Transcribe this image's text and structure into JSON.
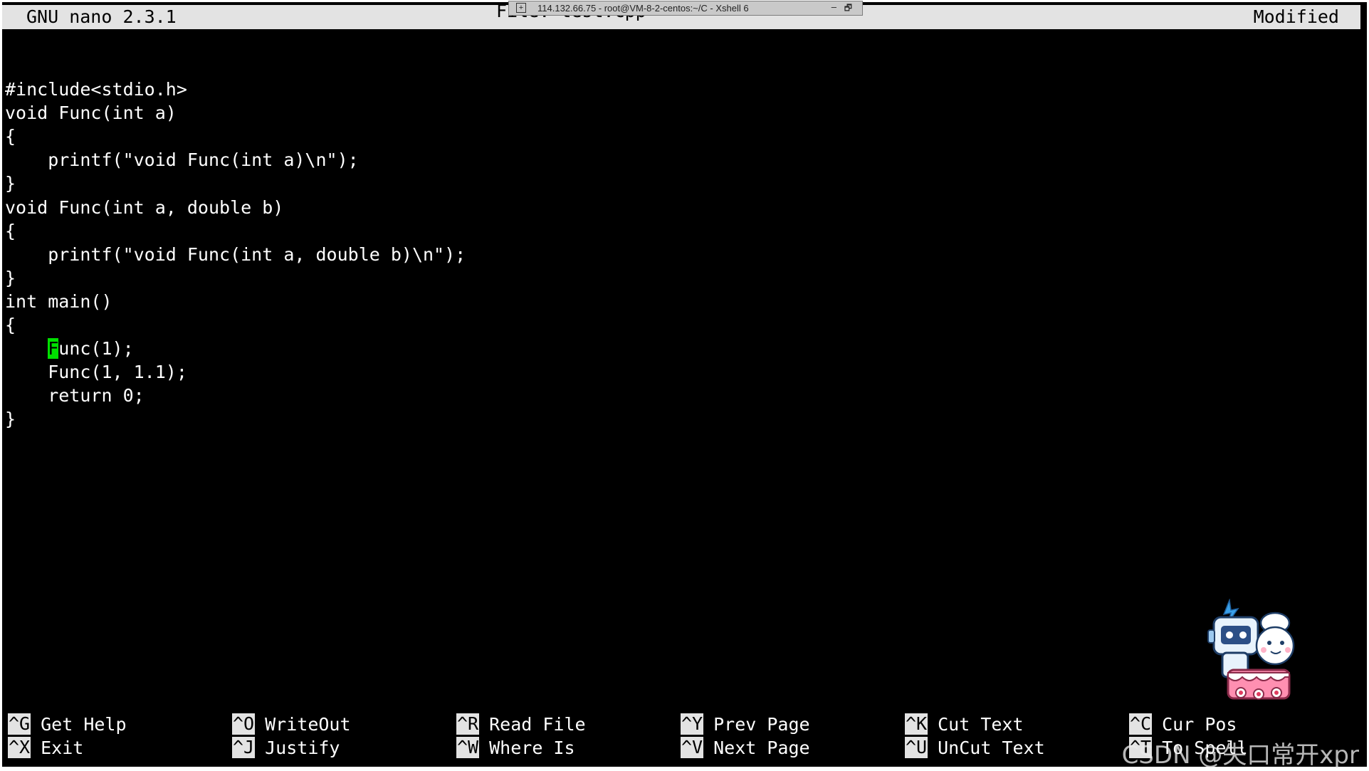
{
  "xshell": {
    "window_title": "114.132.66.75 - root@VM-8-2-centos:~/C - Xshell 6",
    "minimize_glyph": "–",
    "restore_glyph": "🗗",
    "icon_glyph": "+"
  },
  "nano": {
    "version_label": "GNU nano 2.3.1",
    "file_label": "File: test.cpp",
    "status": "Modified"
  },
  "editor": {
    "lines": [
      "",
      "#include<stdio.h>",
      "void Func(int a)",
      "{",
      "    printf(\"void Func(int a)\\n\");",
      "}",
      "void Func(int a, double b)",
      "{",
      "    printf(\"void Func(int a, double b)\\n\");",
      "}",
      "int main()",
      "{",
      "",
      "    Func(1, 1.1);",
      "    return 0;",
      "}"
    ],
    "cursor_line": {
      "indent": "    ",
      "cursor_char": "F",
      "rest": "unc(1);"
    },
    "cursor_color": "#00e000"
  },
  "shortcuts": [
    {
      "key": "^G",
      "label": "Get Help"
    },
    {
      "key": "^O",
      "label": "WriteOut"
    },
    {
      "key": "^R",
      "label": "Read File"
    },
    {
      "key": "^Y",
      "label": "Prev Page"
    },
    {
      "key": "^K",
      "label": "Cut Text"
    },
    {
      "key": "^C",
      "label": "Cur Pos"
    },
    {
      "key": "^X",
      "label": "Exit"
    },
    {
      "key": "^J",
      "label": "Justify"
    },
    {
      "key": "^W",
      "label": "Where Is"
    },
    {
      "key": "^V",
      "label": "Next Page"
    },
    {
      "key": "^U",
      "label": "UnCut Text"
    },
    {
      "key": "^T",
      "label": "To Spell"
    }
  ],
  "watermark": "CSDN @失口常开xpr",
  "colors": {
    "terminal_bg": "#000000",
    "terminal_fg": "#ffffff",
    "inverse_bg": "#e3e3e3"
  }
}
